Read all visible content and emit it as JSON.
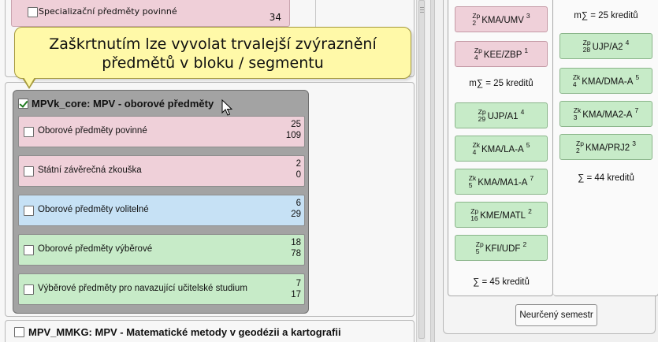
{
  "left": {
    "top_segment": {
      "label": "Specializační předměty povinné",
      "count": "34"
    },
    "tooltip": {
      "line1": "Zaškrtnutím lze vyvolat trvalejší zvýraznění",
      "line2": "předmětů v bloku / segmentu"
    },
    "block": {
      "title": "MPVk_core: MPV - oborové předměty",
      "checked": true,
      "segments": [
        {
          "label": "Oborové předměty povinné",
          "top": "25",
          "bottom": "109",
          "color": "#efd0d9"
        },
        {
          "label": "Státní závěrečná zkouška",
          "top": "2",
          "bottom": "0",
          "color": "#efd0d9"
        },
        {
          "label": "Oborové předměty volitelné",
          "top": "6",
          "bottom": "29",
          "color": "#c6e1f5"
        },
        {
          "label": "Oborové předměty výběrové",
          "top": "18",
          "bottom": "78",
          "color": "#c7ebc8"
        },
        {
          "label": "Výběrové předměty pro navazující učitelské studium",
          "top": "7",
          "bottom": "17",
          "color": "#c7ebc8"
        }
      ]
    },
    "block2": {
      "title": "MPV_MMKG: MPV - Matematické metody v geodézii a kartografii"
    }
  },
  "right": {
    "col1": {
      "courses": [
        {
          "type": "Zp",
          "sem": "2",
          "code": "KMA/UMV",
          "credits": "3",
          "color": "#efd0d9"
        },
        {
          "type": "Zp",
          "sem": "4",
          "code": "KEE/ZBP",
          "credits": "1",
          "color": "#efd0d9"
        }
      ],
      "msum": "m∑ = 25 kreditů",
      "courses2": [
        {
          "type": "Zp",
          "sem": "29",
          "code": "UJP/A1",
          "credits": "4",
          "color": "#c7ebc8"
        },
        {
          "type": "Zk",
          "sem": "4",
          "code": "KMA/LA-A",
          "credits": "5",
          "color": "#c7ebc8"
        },
        {
          "type": "Zk",
          "sem": "5",
          "code": "KMA/MA1-A",
          "credits": "7",
          "color": "#c7ebc8"
        },
        {
          "type": "Zp",
          "sem": "16",
          "code": "KME/MATL",
          "credits": "2",
          "color": "#c7ebc8"
        },
        {
          "type": "Zp",
          "sem": "5",
          "code": "KFI/UDF",
          "credits": "2",
          "color": "#c7ebc8"
        }
      ],
      "sum": "∑ = 45 kreditů"
    },
    "col2": {
      "msum": "m∑ = 25 kreditů",
      "courses": [
        {
          "type": "Zp",
          "sem": "28",
          "code": "UJP/A2",
          "credits": "4",
          "color": "#c7ebc8"
        },
        {
          "type": "Zk",
          "sem": "4",
          "code": "KMA/DMA-A",
          "credits": "5",
          "color": "#c7ebc8"
        },
        {
          "type": "Zk",
          "sem": "3",
          "code": "KMA/MA2-A",
          "credits": "7",
          "color": "#c7ebc8"
        },
        {
          "type": "Zp",
          "sem": "2",
          "code": "KMA/PRJ2",
          "credits": "3",
          "color": "#c7ebc8"
        }
      ],
      "sum": "∑ = 44 kreditů"
    },
    "unassigned_button": "Neurčený semestr"
  }
}
